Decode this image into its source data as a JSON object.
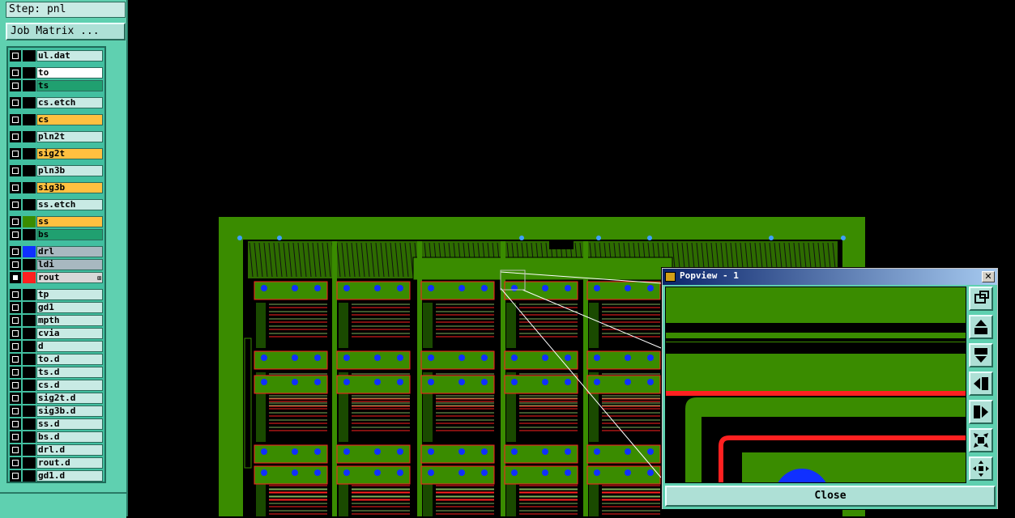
{
  "step": {
    "label": "Step: pnl"
  },
  "job_matrix_button": {
    "label": "Job Matrix ..."
  },
  "layers": [
    {
      "name": "ul.dat",
      "color": "#c8eae4",
      "swatch": "#000000"
    },
    {
      "name": "to",
      "color": "#ffffff",
      "swatch": "#000000"
    },
    {
      "name": "ts",
      "color": "#20a070",
      "swatch": "#000000"
    },
    {
      "name": "cs.etch",
      "color": "#c8eae4",
      "swatch": "#000000"
    },
    {
      "name": "cs",
      "color": "#ffc040",
      "swatch": "#000000"
    },
    {
      "name": "pln2t",
      "color": "#c8eae4",
      "swatch": "#000000"
    },
    {
      "name": "sig2t",
      "color": "#ffc040",
      "swatch": "#000000"
    },
    {
      "name": "pln3b",
      "color": "#c8eae4",
      "swatch": "#000000"
    },
    {
      "name": "sig3b",
      "color": "#ffc040",
      "swatch": "#000000"
    },
    {
      "name": "ss.etch",
      "color": "#c8eae4",
      "swatch": "#000000"
    },
    {
      "name": "ss",
      "color": "#ffc040",
      "swatch": "#3a8c00"
    },
    {
      "name": "bs",
      "color": "#20a070",
      "swatch": "#000000"
    },
    {
      "name": "drl",
      "color": "#a8b8c0",
      "swatch": "#1030ff"
    },
    {
      "name": "ldi",
      "color": "#a8b8c0",
      "swatch": "#000000"
    },
    {
      "name": "rout",
      "color": "#d8d8d8",
      "swatch": "#ff2020",
      "active": true,
      "marker": "⊞"
    },
    {
      "name": "tp",
      "color": "#c8eae4",
      "swatch": "#000000"
    },
    {
      "name": "gd1",
      "color": "#c8eae4",
      "swatch": "#000000"
    },
    {
      "name": "mpth",
      "color": "#c8eae4",
      "swatch": "#000000"
    },
    {
      "name": "cvia",
      "color": "#c8eae4",
      "swatch": "#000000"
    },
    {
      "name": "d",
      "color": "#c8eae4",
      "swatch": "#000000"
    },
    {
      "name": "to.d",
      "color": "#c8eae4",
      "swatch": "#000000"
    },
    {
      "name": "ts.d",
      "color": "#c8eae4",
      "swatch": "#000000"
    },
    {
      "name": "cs.d",
      "color": "#c8eae4",
      "swatch": "#000000"
    },
    {
      "name": "sig2t.d",
      "color": "#c8eae4",
      "swatch": "#000000"
    },
    {
      "name": "sig3b.d",
      "color": "#c8eae4",
      "swatch": "#000000"
    },
    {
      "name": "ss.d",
      "color": "#c8eae4",
      "swatch": "#000000"
    },
    {
      "name": "bs.d",
      "color": "#c8eae4",
      "swatch": "#000000"
    },
    {
      "name": "drl.d",
      "color": "#c8eae4",
      "swatch": "#000000"
    },
    {
      "name": "rout.d",
      "color": "#c8eae4",
      "swatch": "#000000"
    },
    {
      "name": "gd1.d",
      "color": "#c8eae4",
      "swatch": "#000000"
    }
  ],
  "popview": {
    "title": "Popview - 1",
    "close_x": "✕",
    "close_label": "Close",
    "tools": [
      "zoom-fit-icon",
      "pan-up-icon",
      "pan-down-icon",
      "pan-left-icon",
      "pan-right-icon",
      "zoom-out-icon",
      "zoom-in-icon"
    ]
  },
  "colors": {
    "board": "#3a8c00",
    "panel": "#5fd0b0",
    "trace_red": "#ff2020",
    "drill_blue": "#1030ff"
  }
}
